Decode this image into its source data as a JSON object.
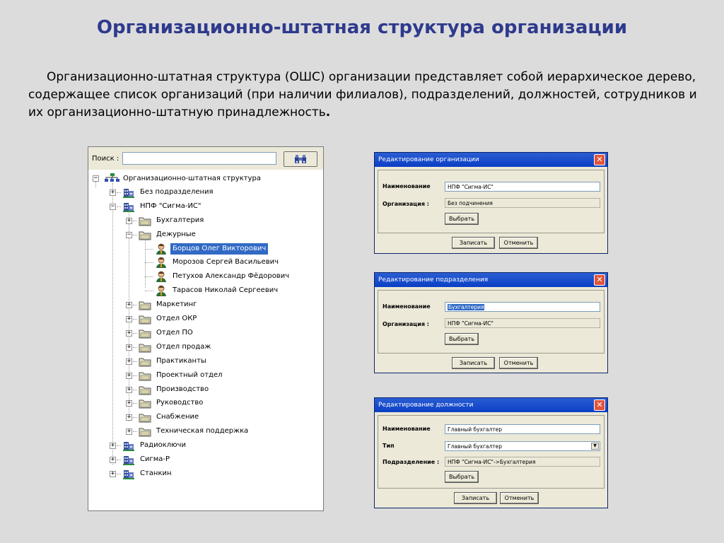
{
  "page": {
    "title": "Организационно-штатная структура организации",
    "intro": "Организационно-штатная структура (ОШС) организации представляет собой иерархическое дерево, содержащее список организаций (при наличии филиалов), подразделений, должностей, сотрудников и их организационно-штатную принадлежность",
    "intro_end": "."
  },
  "tree": {
    "search_label": "Поиск :",
    "search_value": "",
    "search_icon": "binoculars-icon",
    "root": "Организационно-штатная структура",
    "items": [
      {
        "label": "Без подразделения",
        "icon": "building-icon",
        "expander": "+"
      },
      {
        "label": "НПФ \"Сигма-ИС\"",
        "icon": "building-icon",
        "expander": "−"
      },
      {
        "label": "Бухгалтерия",
        "icon": "folder-icon",
        "expander": "+"
      },
      {
        "label": "Дежурные",
        "icon": "folder-icon",
        "expander": "−"
      },
      {
        "label": "Борцов Олег Викторович",
        "icon": "person-icon",
        "selected": true
      },
      {
        "label": "Морозов Сергей Васильевич",
        "icon": "person-icon"
      },
      {
        "label": "Петухов Александр Фёдорович",
        "icon": "person-icon"
      },
      {
        "label": "Тарасов Николай Сергеевич",
        "icon": "person-icon"
      },
      {
        "label": "Маркетинг",
        "icon": "folder-icon",
        "expander": "+"
      },
      {
        "label": "Отдел ОКР",
        "icon": "folder-icon",
        "expander": "+"
      },
      {
        "label": "Отдел ПО",
        "icon": "folder-icon",
        "expander": "+"
      },
      {
        "label": "Отдел продаж",
        "icon": "folder-icon",
        "expander": "+"
      },
      {
        "label": "Практиканты",
        "icon": "folder-icon",
        "expander": "+"
      },
      {
        "label": "Проектный отдел",
        "icon": "folder-icon",
        "expander": "+"
      },
      {
        "label": "Производство",
        "icon": "folder-icon",
        "expander": "+"
      },
      {
        "label": "Руководство",
        "icon": "folder-icon",
        "expander": "+"
      },
      {
        "label": "Снабжение",
        "icon": "folder-icon",
        "expander": "+"
      },
      {
        "label": "Техническая поддержка",
        "icon": "folder-icon",
        "expander": "+"
      },
      {
        "label": "Радиоключи",
        "icon": "building-icon",
        "expander": "+"
      },
      {
        "label": "Сигма-Р",
        "icon": "building-icon",
        "expander": "+"
      },
      {
        "label": "Станкин",
        "icon": "building-icon",
        "expander": "+"
      }
    ]
  },
  "dialog_org": {
    "title": "Редактирование организации",
    "name_label": "Наименование",
    "name_value": "НПФ \"Сигма-ИС\"",
    "org_label": "Организация :",
    "org_value": "Без подчинения",
    "choose": "Выбрать",
    "save": "Записать",
    "cancel": "Отменить"
  },
  "dialog_dept": {
    "title": "Редактирование подразделения",
    "name_label": "Наименование",
    "name_value": "Бухгалтерия",
    "org_label": "Организация :",
    "org_value": "НПФ \"Сигма-ИС\"",
    "choose": "Выбрать",
    "save": "Записать",
    "cancel": "Отменить"
  },
  "dialog_pos": {
    "title": "Редактирование должности",
    "name_label": "Наименование",
    "name_value": "Главный бухгалтер",
    "type_label": "Тип",
    "type_value": "Главный бухгалтер",
    "dept_label": "Подразделение :",
    "dept_value": "НПФ \"Сигма-ИС\"->Бухгалтерия",
    "choose": "Выбрать",
    "save": "Записать",
    "cancel": "Отменить"
  },
  "colors": {
    "title": "#2e3a8c",
    "selection": "#316ac5",
    "dialog_titlebar": "#0a3fc4"
  }
}
